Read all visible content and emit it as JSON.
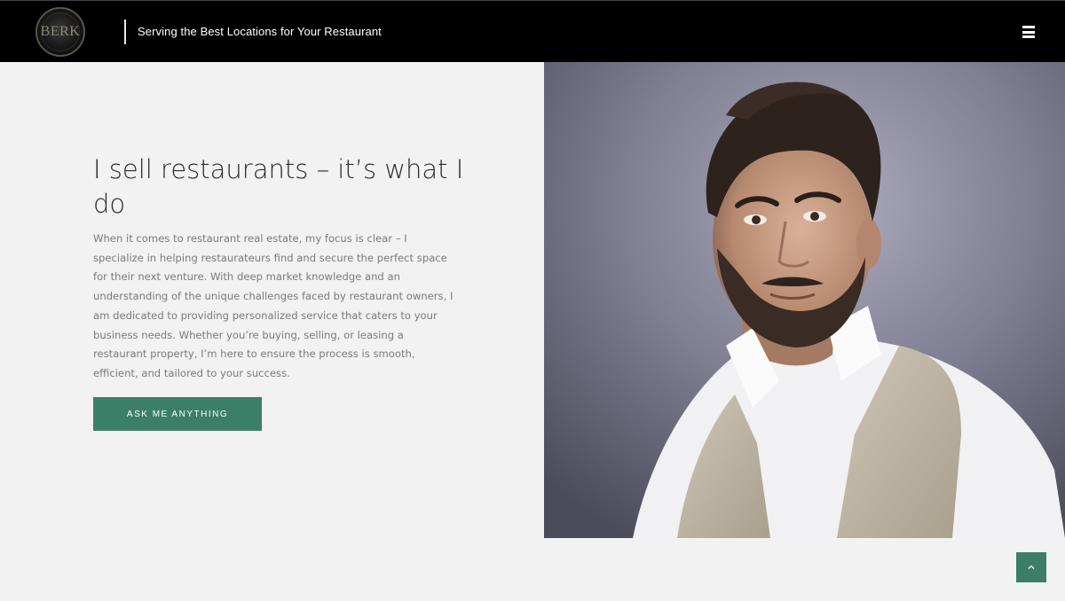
{
  "header": {
    "logo_text": "BERK",
    "tagline": "Serving the Best Locations for Your Restaurant",
    "menu_icon": "hamburger-menu-icon"
  },
  "hero": {
    "title": "I sell restaurants – it’s what I do",
    "body": "When it comes to restaurant real estate, my focus is clear – I specialize in helping restaurateurs find and secure the perfect space for their next venture. With deep market knowledge and an understanding of the unique challenges faced by restaurant owners, I am dedicated to providing personalized service that caters to your business needs. Whether you’re buying, selling, or leasing a restaurant property, I’m here to ensure the process is smooth, efficient, and tailored to your success.",
    "cta_label": "ASK ME ANYTHING"
  },
  "colors": {
    "header_bg": "#000000",
    "page_bg": "#f3f2f3",
    "accent_green": "#3c7f68",
    "heading_text": "#2b2b2b",
    "body_text": "#7a7a7a"
  },
  "back_to_top_icon": "chevron-up-icon"
}
